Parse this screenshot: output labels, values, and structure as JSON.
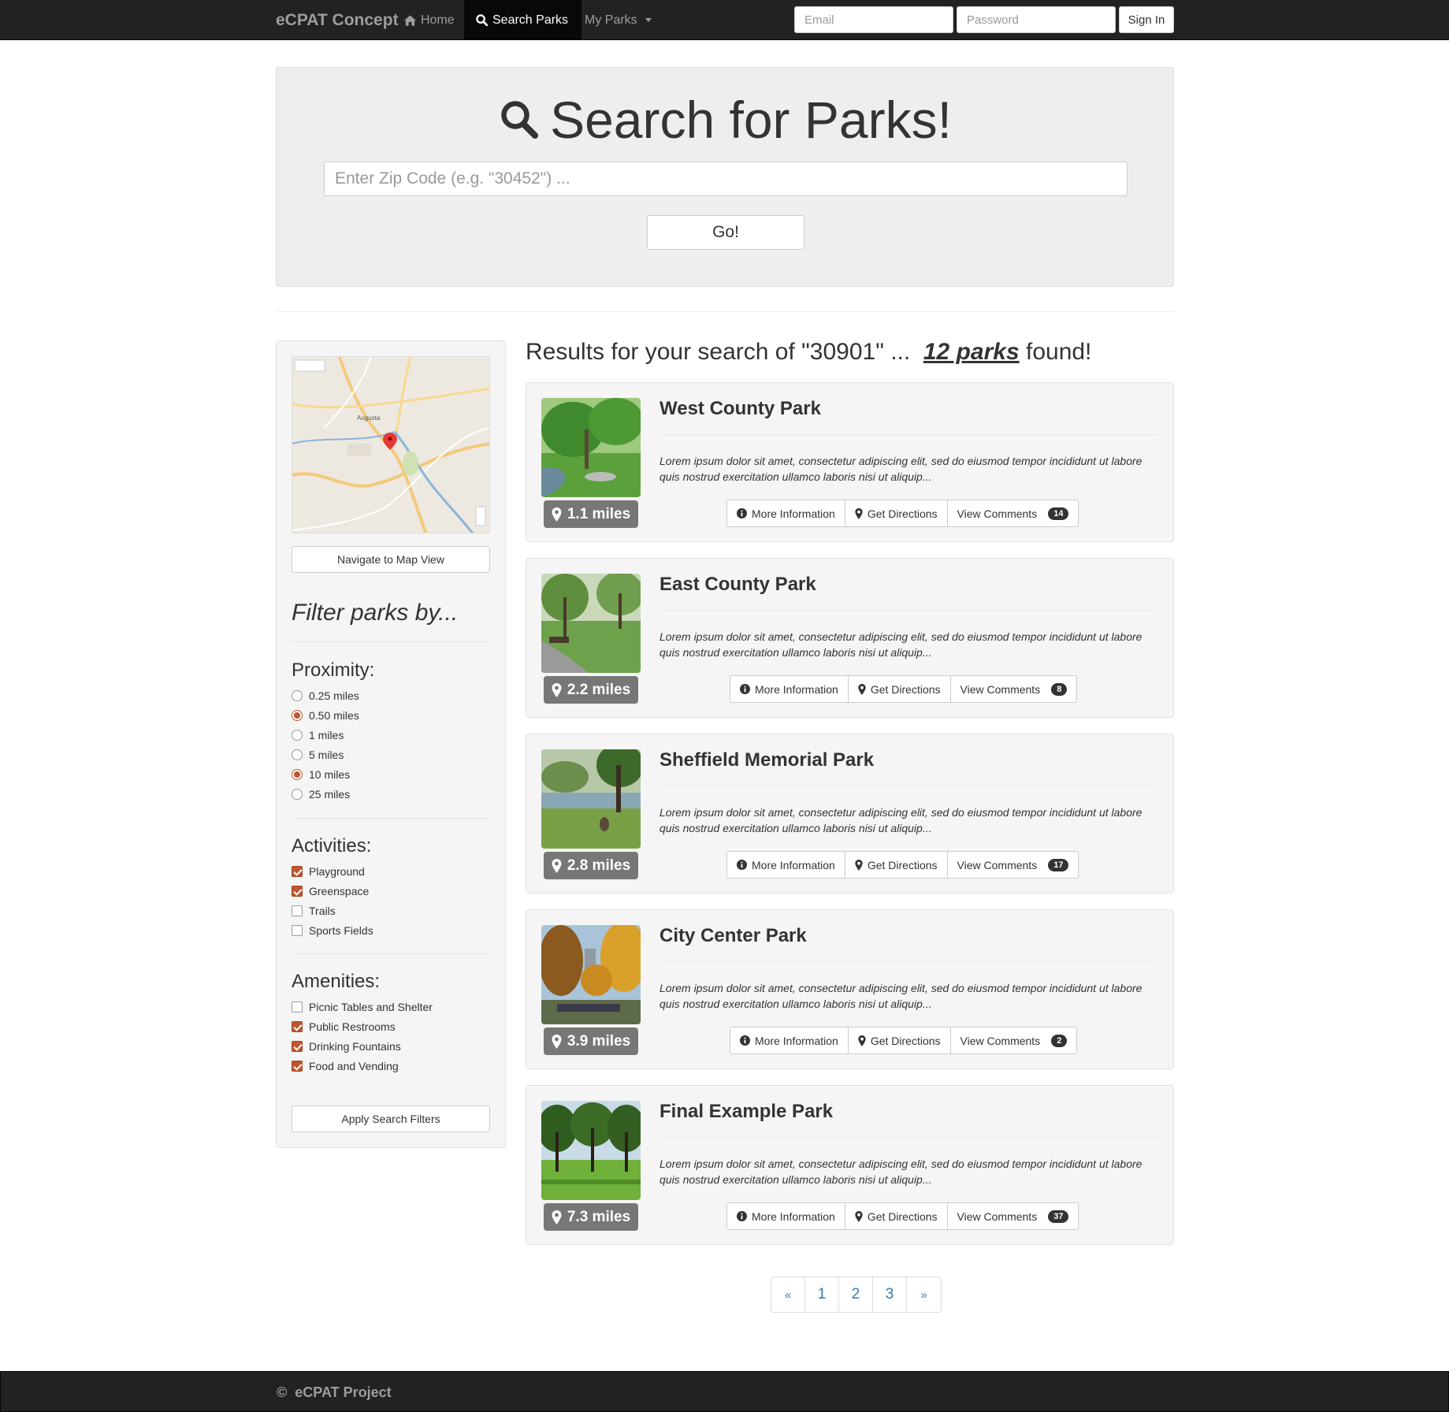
{
  "navbar": {
    "brand": "eCPAT Concept",
    "home": "Home",
    "search_parks": "Search Parks",
    "my_parks": "My Parks",
    "email_placeholder": "Email",
    "password_placeholder": "Password",
    "sign_in": "Sign In"
  },
  "jumbotron": {
    "title": "Search for Parks!",
    "zip_placeholder": "Enter Zip Code (e.g. \"30452\") ...",
    "go": "Go!"
  },
  "sidebar": {
    "map_view_button": "Navigate to Map View",
    "filter_title": "Filter parks by...",
    "proximity_title": "Proximity:",
    "proximity": [
      {
        "label": "0.25 miles",
        "checked": false
      },
      {
        "label": "0.50 miles",
        "checked": true
      },
      {
        "label": "1 miles",
        "checked": false
      },
      {
        "label": "5 miles",
        "checked": false
      },
      {
        "label": "10 miles",
        "checked": true
      },
      {
        "label": "25 miles",
        "checked": false
      }
    ],
    "activities_title": "Activities:",
    "activities": [
      {
        "label": "Playground",
        "checked": true
      },
      {
        "label": "Greenspace",
        "checked": true
      },
      {
        "label": "Trails",
        "checked": false
      },
      {
        "label": "Sports Fields",
        "checked": false
      }
    ],
    "amenities_title": "Amenities:",
    "amenities": [
      {
        "label": "Picnic Tables and Shelter",
        "checked": false
      },
      {
        "label": "Public Restrooms",
        "checked": true
      },
      {
        "label": "Drinking Fountains",
        "checked": true
      },
      {
        "label": "Food and Vending",
        "checked": true
      }
    ],
    "apply_button": "Apply Search Filters",
    "map": {
      "city_label": "Augusta",
      "marker_color": "#e53935"
    }
  },
  "results": {
    "heading_prefix": "Results for your search of \"30901\" ...",
    "count_text": "12 parks",
    "heading_suffix": "found!",
    "buttons": {
      "more_info": "More Information",
      "directions": "Get Directions",
      "comments": "View Comments"
    },
    "parks": [
      {
        "name": "West County Park",
        "distance": "1.1 miles",
        "comments": "14",
        "description": "Lorem ipsum dolor sit amet, consectetur adipiscing elit, sed do eiusmod tempor incididunt ut labore quis nostrud exercitation ullamco laboris nisi ut aliquip..."
      },
      {
        "name": "East County Park",
        "distance": "2.2 miles",
        "comments": "8",
        "description": "Lorem ipsum dolor sit amet, consectetur adipiscing elit, sed do eiusmod tempor incididunt ut labore quis nostrud exercitation ullamco laboris nisi ut aliquip..."
      },
      {
        "name": "Sheffield Memorial Park",
        "distance": "2.8 miles",
        "comments": "17",
        "description": "Lorem ipsum dolor sit amet, consectetur adipiscing elit, sed do eiusmod tempor incididunt ut labore quis nostrud exercitation ullamco laboris nisi ut aliquip..."
      },
      {
        "name": "City Center Park",
        "distance": "3.9 miles",
        "comments": "2",
        "description": "Lorem ipsum dolor sit amet, consectetur adipiscing elit, sed do eiusmod tempor incididunt ut labore quis nostrud exercitation ullamco laboris nisi ut aliquip..."
      },
      {
        "name": "Final Example Park",
        "distance": "7.3 miles",
        "comments": "37",
        "description": "Lorem ipsum dolor sit amet, consectetur adipiscing elit, sed do eiusmod tempor incididunt ut labore quis nostrud exercitation ullamco laboris nisi ut aliquip..."
      }
    ]
  },
  "pagination": {
    "prev": "«",
    "pages": [
      "1",
      "2",
      "3"
    ],
    "next": "»"
  },
  "footer": {
    "copyright_symbol": "©",
    "text": "eCPAT Project"
  },
  "colors": {
    "navbar": "#222222",
    "accent_check": "#c0562f",
    "link": "#337ab7",
    "badge": "#777777"
  }
}
